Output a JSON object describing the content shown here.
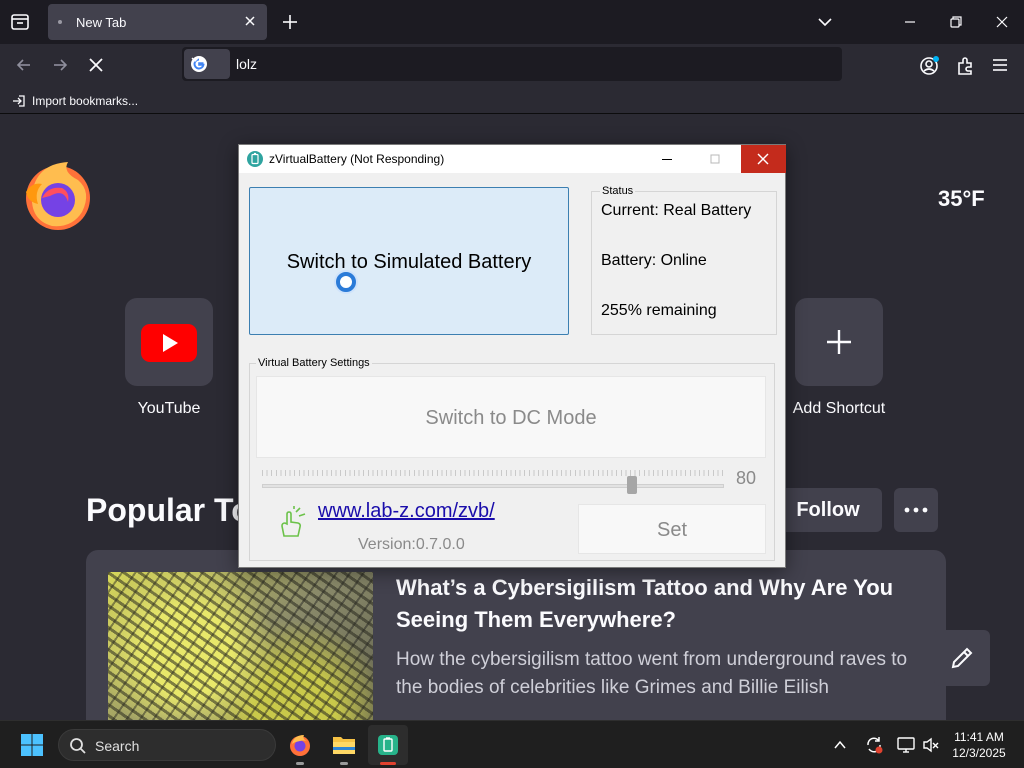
{
  "browser": {
    "tab": {
      "title": "New Tab"
    },
    "urlbar": {
      "text": "lolz"
    },
    "bookmarks": {
      "import_label": "Import bookmarks..."
    }
  },
  "newtab": {
    "weather": "35°F",
    "shortcuts": [
      {
        "label": "YouTube",
        "icon": "youtube-icon"
      },
      {
        "label": "Add Shortcut",
        "icon": "plus-icon"
      }
    ],
    "popular": {
      "title": "Popular To",
      "follow_label": "Follow"
    },
    "story": {
      "title": "What’s a Cybersigilism Tattoo and Why Are You Seeing Them Everywhere?",
      "description": "How the cybersigilism tattoo went from underground raves to the bodies of celebrities like Grimes and Billie Eilish"
    }
  },
  "zvb": {
    "title": "zVirtualBattery (Not Responding)",
    "switch_label": "Switch to Simulated Battery",
    "status": {
      "legend": "Status",
      "current": "Current: Real Battery",
      "battery": "Battery: Online",
      "remaining": "255% remaining"
    },
    "settings": {
      "legend": "Virtual Battery Settings",
      "dc_label": "Switch to DC Mode",
      "slider_value": "80",
      "slider_level": 80,
      "link": "www.lab-z.com/zvb/",
      "version": "Version:0.7.0.0",
      "set_label": "Set"
    }
  },
  "taskbar": {
    "search_label": "Search",
    "apps": [
      "firefox-icon",
      "file-explorer-icon",
      "zvirtualbattery-icon"
    ],
    "time": "11:41 AM",
    "date": "12/3/2025"
  },
  "colors": {
    "browser_bg": "#2b2a33",
    "tile_bg": "#42414d",
    "close_red": "#c42b1c",
    "link_blue": "#1a0dab"
  }
}
